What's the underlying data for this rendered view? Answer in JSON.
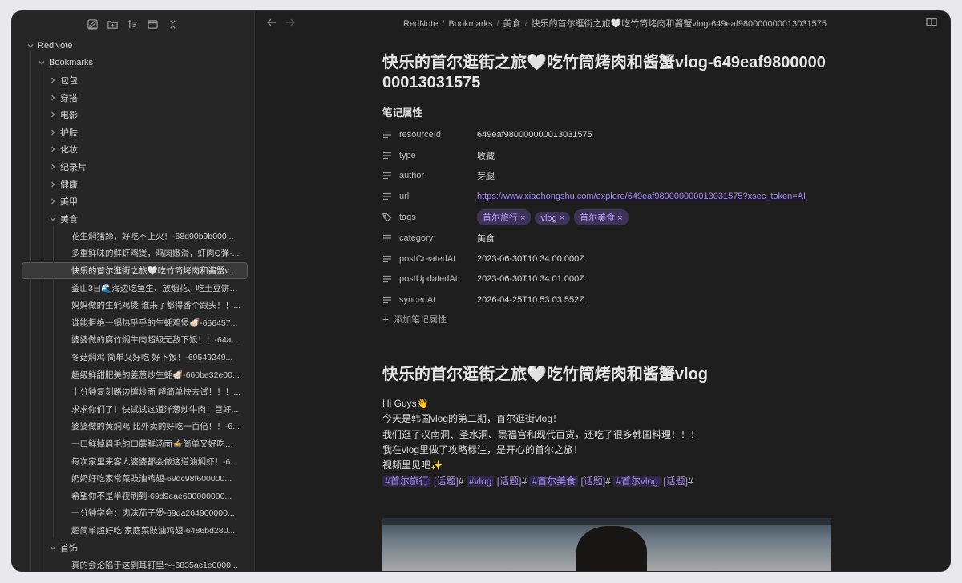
{
  "toolbar": {
    "icons": [
      "new-note-icon",
      "new-folder-icon",
      "sort-icon",
      "collapse-icon",
      "collapse-all-icon"
    ]
  },
  "sidebar": {
    "vault": "RedNote",
    "bookmarks": "Bookmarks",
    "folders": [
      "包包",
      "穿搭",
      "电影",
      "护肤",
      "化妆",
      "纪录片",
      "健康",
      "美甲"
    ],
    "open_folder": "美食",
    "files": [
      "花生焖猪蹄，好吃不上火！-68d90b9b000...",
      "多重鲜味的鲜虾鸡煲，鸡肉嫩滑，虾肉Q弹-...",
      "快乐的首尔逛街之旅🤍吃竹筒烤肉和酱蟹vlo...",
      "釜山3日🌊海边吃鱼生、放烟花、吃土豆饼vl...",
      "妈妈做的生蚝鸡煲 谁来了都得香个跟头！！...",
      "谁能拒绝一锅热乎乎的生蚝鸡煲🦪-656457...",
      "婆婆做的腐竹焖牛肉超级无敌下饭！！-64a...",
      "冬菇焖鸡 简单又好吃 好下饭！-69549249...",
      "超级鲜甜肥美的姜葱炒生蚝🦪-660be32e00...",
      "十分钟复刻路边摊炒面 超简单快去试！！！...",
      "求求你们了！快试试这道洋葱炒牛肉！巨好...",
      "婆婆做的黄焖鸡 比外卖的好吃一百倍！！-6...",
      "一口鲜掉眉毛的口蘑鲜汤面🍲简单又好吃❗-...",
      "每次家里来客人婆婆都会做这道油焖虾！-6...",
      "奶奶好吃家常菜豉油鸡翅-69dc98f600000...",
      "希望你不是半夜刷到-69d9eae600000000...",
      "一分钟学会：肉沫茄子煲-69da264900000...",
      "超简单超好吃 家庭菜豉油鸡翅-6486bd280..."
    ],
    "next_folder": "首饰",
    "next_file": "真的会沦陷于这副耳钉里～-6835ac1e0000..."
  },
  "breadcrumb": [
    "RedNote",
    "Bookmarks",
    "美食",
    "快乐的首尔逛街之旅🤍吃竹筒烤肉和酱蟹vlog-649eaf980000000013031575"
  ],
  "note": {
    "title": "快乐的首尔逛街之旅🤍吃竹筒烤肉和酱蟹vlog-649eaf980000000013031575",
    "props_heading": "笔记属性",
    "properties": [
      {
        "key": "resourceId",
        "value": "649eaf980000000013031575",
        "icon": "text-lines-icon"
      },
      {
        "key": "type",
        "value": "收藏",
        "icon": "text-lines-icon"
      },
      {
        "key": "author",
        "value": "芽腿",
        "icon": "text-lines-icon"
      },
      {
        "key": "url",
        "value": "https://www.xiaohongshu.com/explore/649eaf980000000013031575?xsec_token=AI",
        "icon": "text-lines-icon"
      },
      {
        "key": "tags",
        "value": "",
        "icon": "tags-icon"
      },
      {
        "key": "category",
        "value": "美食",
        "icon": "text-lines-icon"
      },
      {
        "key": "postCreatedAt",
        "value": "2023-06-30T10:34:00.000Z",
        "icon": "text-lines-icon"
      },
      {
        "key": "postUpdatedAt",
        "value": "2023-06-30T10:34:01.000Z",
        "icon": "text-lines-icon"
      },
      {
        "key": "syncedAt",
        "value": "2026-04-25T10:53:03.552Z",
        "icon": "text-lines-icon"
      }
    ],
    "tags": [
      "首尔旅行",
      "vlog",
      "首尔美食"
    ],
    "add_property": "添加笔记属性",
    "heading": "快乐的首尔逛街之旅🤍吃竹筒烤肉和酱蟹vlog",
    "lines": [
      "Hi Guys👋",
      "今天是韩国vlog的第二期，首尔逛街vlog！",
      "我们逛了汉南洞、圣水洞、景福宫和现代百货，还吃了很多韩国料理！！！",
      "我在vlog里做了攻略标注，是开心的首尔之旅！",
      "视频里见吧✨"
    ],
    "hashtags": [
      "#首尔旅行",
      "#vlog",
      "#首尔美食",
      "#首尔vlog"
    ],
    "topic_label": "[话题]",
    "hash_suffix": "#"
  }
}
